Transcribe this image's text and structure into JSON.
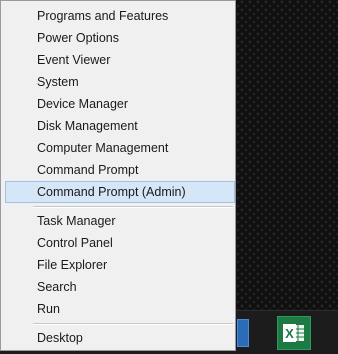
{
  "menu": {
    "groups": [
      [
        "Programs and Features",
        "Power Options",
        "Event Viewer",
        "System",
        "Device Manager",
        "Disk Management",
        "Computer Management",
        "Command Prompt",
        "Command Prompt (Admin)"
      ],
      [
        "Task Manager",
        "Control Panel",
        "File Explorer",
        "Search",
        "Run"
      ],
      [
        "Desktop"
      ]
    ],
    "highlighted_item": "Command Prompt (Admin)"
  },
  "taskbar": {
    "icons": [
      "app-icon",
      "excel-icon"
    ],
    "excel_letter": "X"
  },
  "colors": {
    "menu_background": "#f0f0f0",
    "highlight_fill": "#d5e6f6",
    "highlight_border": "#9fc3e8",
    "excel_green": "#1e7a45"
  }
}
